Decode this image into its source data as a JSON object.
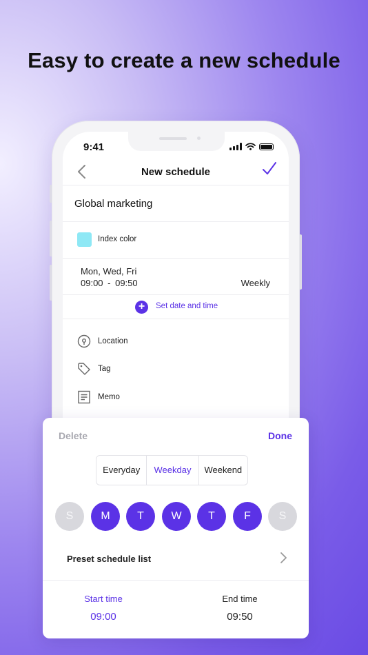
{
  "headline": "Easy to create a new schedule",
  "status": {
    "time": "9:41"
  },
  "nav": {
    "title": "New schedule",
    "back_icon": "chevron-left-icon",
    "confirm_icon": "checkmark-icon"
  },
  "form": {
    "schedule_name": "Global marketing",
    "index_color_label": "Index color",
    "index_color": "#8ee8f5",
    "days": "Mon, Wed, Fri",
    "time_range": "09:00 - 09:50",
    "repeat": "Weekly",
    "set_date_time_label": "Set date and time",
    "options": [
      {
        "label": "Location",
        "icon": "location-pin-icon"
      },
      {
        "label": "Tag",
        "icon": "tag-icon"
      },
      {
        "label": "Memo",
        "icon": "memo-icon"
      }
    ]
  },
  "sheet": {
    "delete_label": "Delete",
    "done_label": "Done",
    "segments": [
      "Everyday",
      "Weekday",
      "Weekend"
    ],
    "selected_segment": "Weekday",
    "days": [
      {
        "label": "S",
        "selected": false
      },
      {
        "label": "M",
        "selected": true
      },
      {
        "label": "T",
        "selected": true
      },
      {
        "label": "W",
        "selected": true
      },
      {
        "label": "T",
        "selected": true
      },
      {
        "label": "F",
        "selected": true
      },
      {
        "label": "S",
        "selected": false
      }
    ],
    "preset_label": "Preset schedule list",
    "start_time_label": "Start time",
    "start_time": "09:00",
    "end_time_label": "End time",
    "end_time": "09:50"
  },
  "colors": {
    "accent": "#5b32e6",
    "inactive_day": "#d8d8dd"
  }
}
